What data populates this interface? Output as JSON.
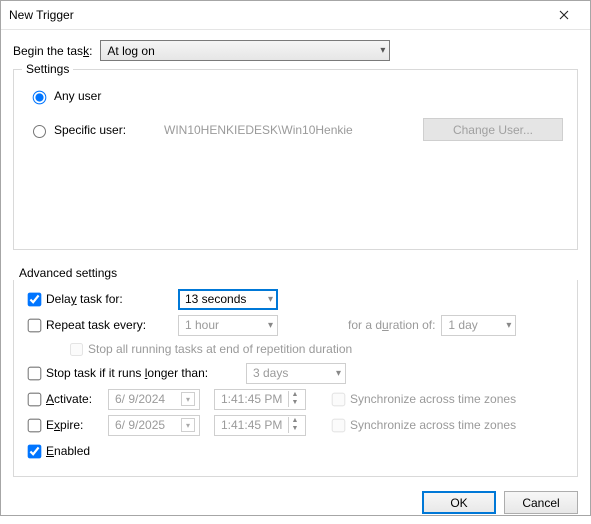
{
  "window": {
    "title": "New Trigger"
  },
  "begin": {
    "label_pre": "Begin the tas",
    "label_u": "k",
    "label_post": ":",
    "value": "At log on"
  },
  "settings": {
    "legend": "Settings",
    "any_user_label": "Any user",
    "any_user_checked": true,
    "specific_user_label": "Specific user:",
    "specific_user_checked": false,
    "specific_user_value": "WIN10HENKIEDESK\\Win10Henkie",
    "change_user_label": "Change User..."
  },
  "adv": {
    "legend": "Advanced settings",
    "delay": {
      "checked": true,
      "label_pre": "Dela",
      "label_u": "y",
      "label_post": " task for:",
      "value": "13 seconds"
    },
    "repeat": {
      "checked": false,
      "label_pre": "Repeat task every",
      "label_post": ":",
      "value": "1 hour",
      "duration_label_pre": "for a d",
      "duration_label_u": "u",
      "duration_label_post": "ration of:",
      "duration_value": "1 day",
      "stop_all_label": "Stop all running tasks at end of repetition duration",
      "stop_all_checked": false
    },
    "stoplong": {
      "checked": false,
      "label_pre": "Stop task if it runs ",
      "label_u": "l",
      "label_post": "onger than:",
      "value": "3 days"
    },
    "activate": {
      "checked": false,
      "label_pre": "",
      "label_u": "A",
      "label_post": "ctivate:",
      "date": "6/  9/2024",
      "time": "1:41:45 PM",
      "sync_label": "Synchronize across time zones",
      "sync_checked": false
    },
    "expire": {
      "checked": false,
      "label_pre": "E",
      "label_u": "x",
      "label_post": "pire:",
      "date": "6/  9/2025",
      "time": "1:41:45 PM",
      "sync_label": "Synchronize across time zones",
      "sync_checked": false
    },
    "enabled": {
      "checked": true,
      "label_u": "E",
      "label_post": "nabled"
    }
  },
  "buttons": {
    "ok": "OK",
    "cancel": "Cancel"
  }
}
